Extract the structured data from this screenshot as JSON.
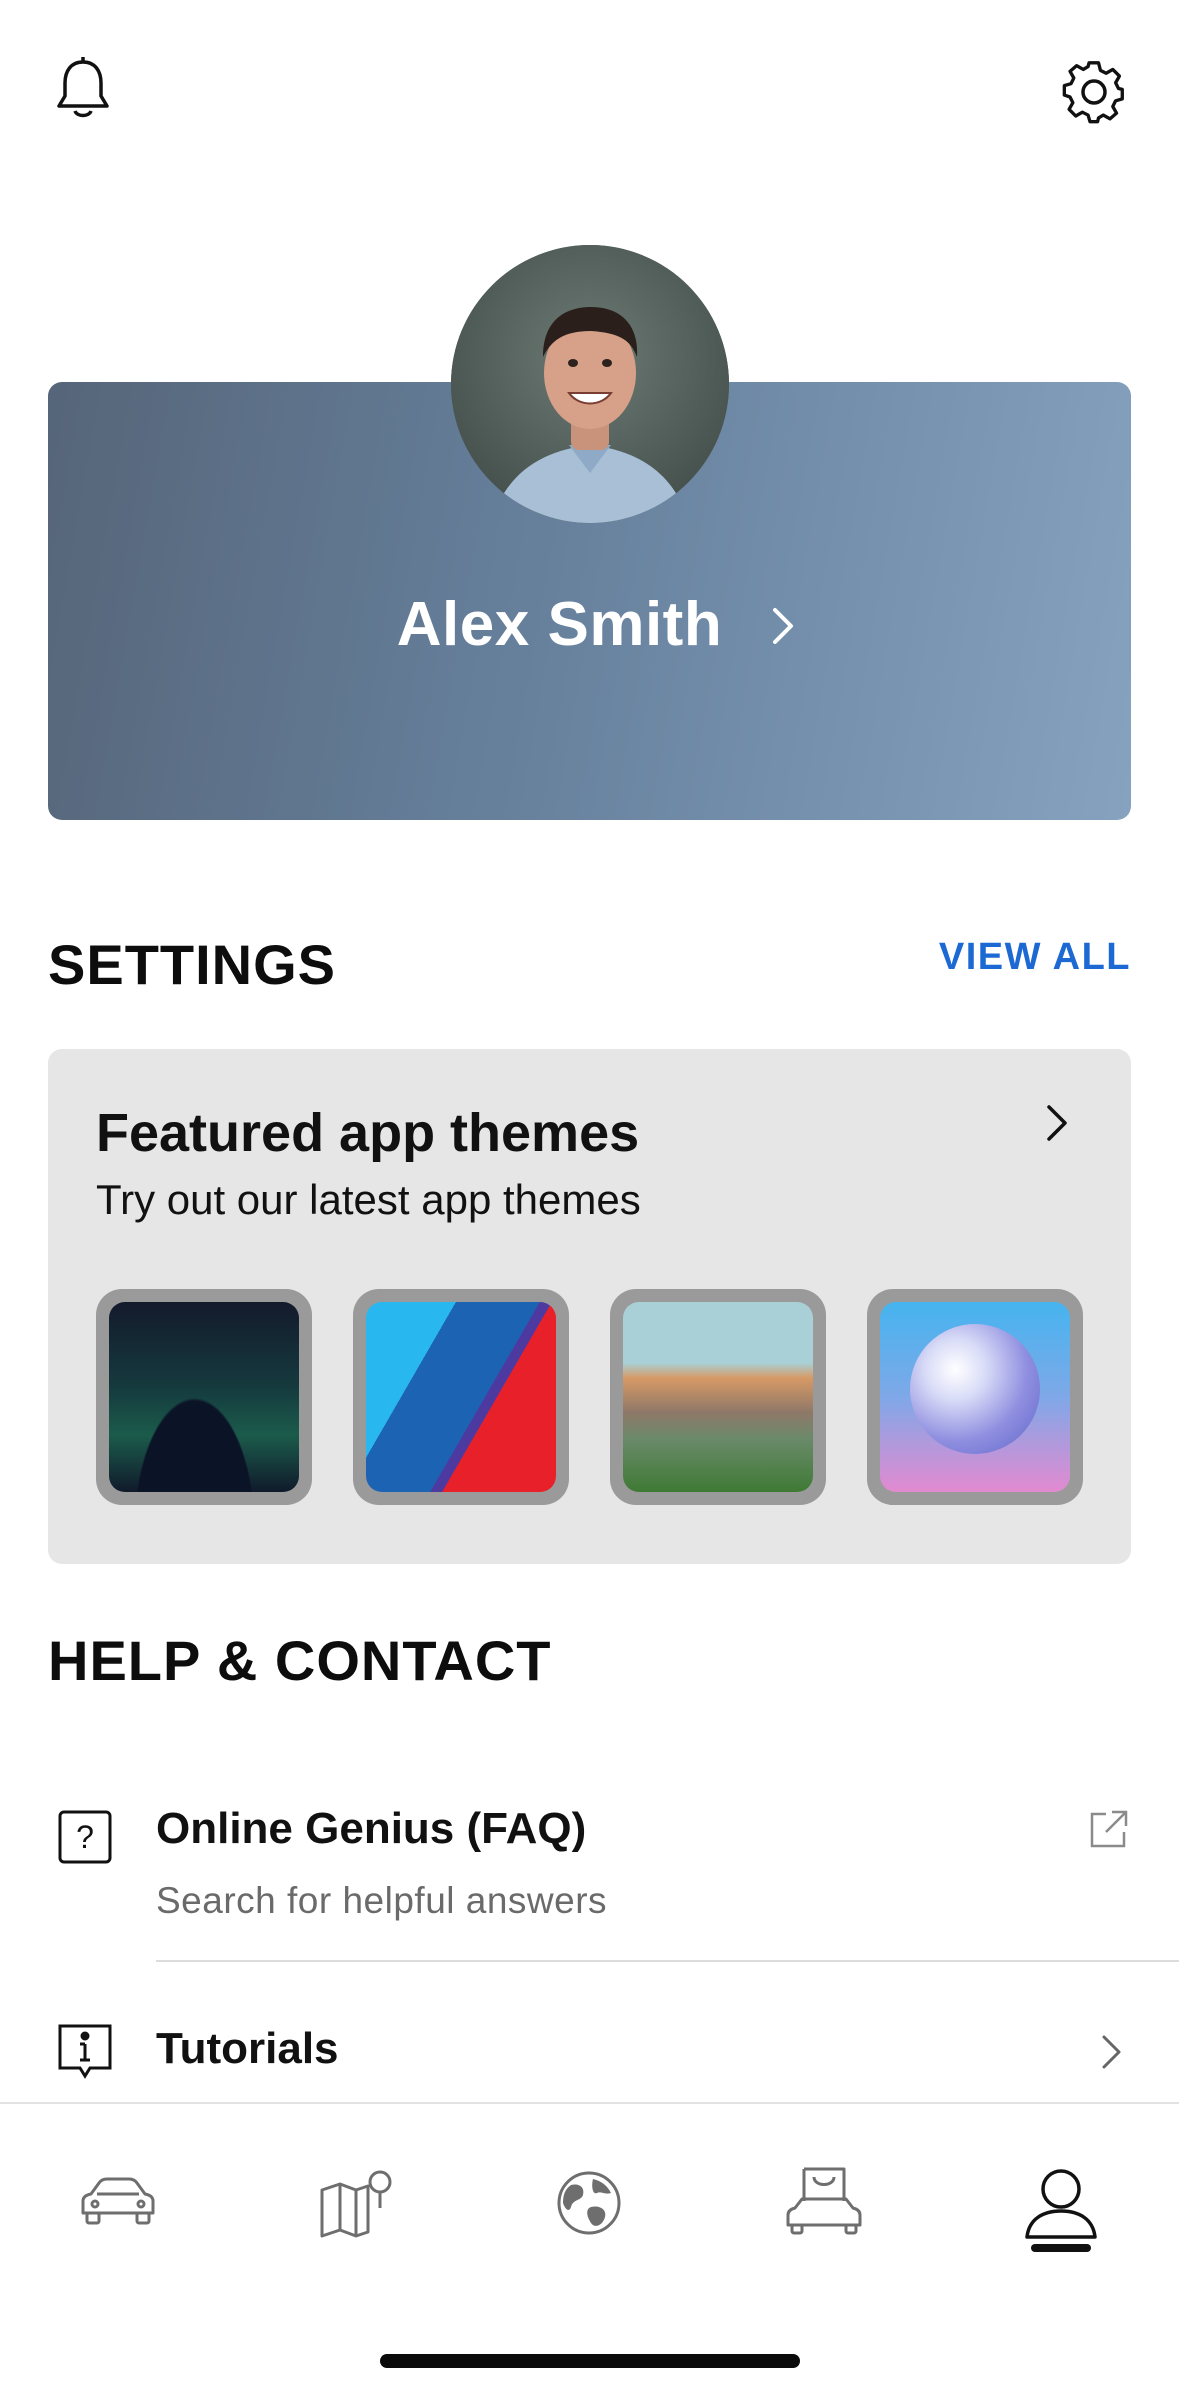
{
  "header": {
    "notifications_icon": "bell-icon",
    "settings_icon": "gear-icon"
  },
  "profile": {
    "name": "Alex Smith",
    "avatar": "profile-photo",
    "card_colors": [
      "#566579",
      "#86a2bf"
    ]
  },
  "settings": {
    "heading": "SETTINGS",
    "view_all": "VIEW ALL",
    "accent": "#1c69d4"
  },
  "themes": {
    "title": "Featured app themes",
    "subtitle": "Try out our latest app themes",
    "items": [
      {
        "name": "aurora-theme"
      },
      {
        "name": "m-stripes-theme"
      },
      {
        "name": "mountain-theme"
      },
      {
        "name": "orb-theme"
      }
    ]
  },
  "help": {
    "heading": "HELP & CONTACT",
    "items": [
      {
        "title": "Online Genius (FAQ)",
        "subtitle": "Search for helpful answers",
        "icon": "question-icon",
        "action_icon": "external-link-icon"
      },
      {
        "title": "Tutorials",
        "icon": "info-icon",
        "action_icon": "chevron-right-icon"
      }
    ]
  },
  "bottom_nav": {
    "items": [
      {
        "name": "vehicle",
        "icon": "car-icon"
      },
      {
        "name": "map",
        "icon": "map-pin-icon"
      },
      {
        "name": "explore",
        "icon": "globe-icon"
      },
      {
        "name": "shop",
        "icon": "shop-car-icon"
      },
      {
        "name": "profile",
        "icon": "person-icon",
        "active": true
      }
    ]
  }
}
